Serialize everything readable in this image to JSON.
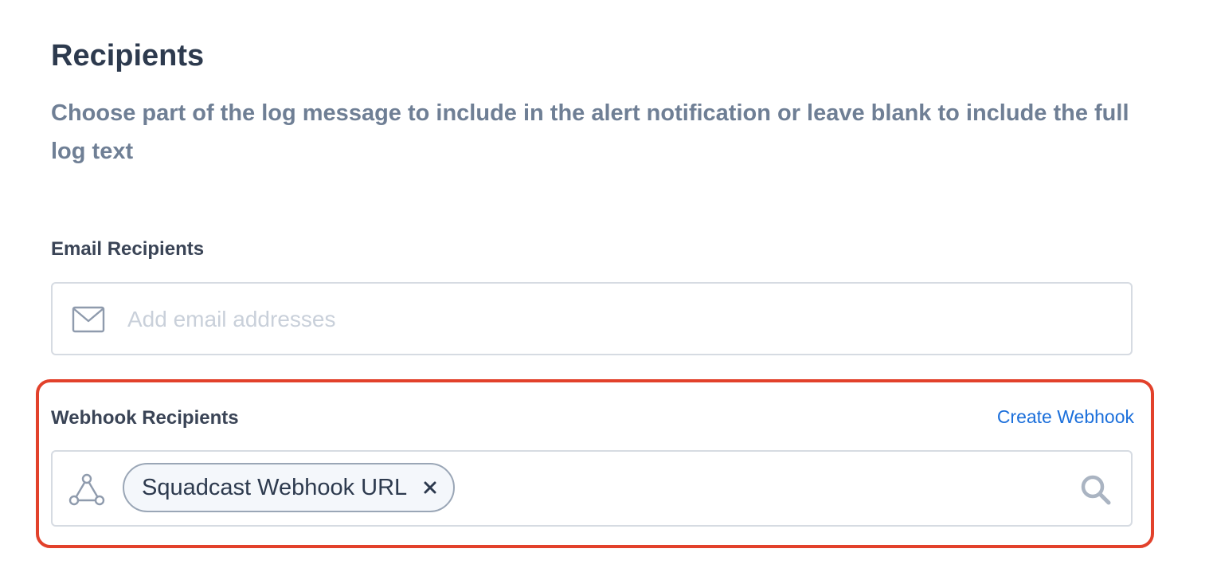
{
  "section": {
    "title": "Recipients",
    "description": "Choose part of the log message to include in the alert notification or leave blank to include the full log text"
  },
  "email": {
    "label": "Email Recipients",
    "placeholder": "Add email addresses",
    "icon": "mail-icon"
  },
  "webhook": {
    "label": "Webhook Recipients",
    "create_link": "Create Webhook",
    "icon": "webhook-icon",
    "chips": [
      {
        "label": "Squadcast Webhook URL",
        "remove_symbol": "×"
      }
    ],
    "search_icon": "search-icon"
  },
  "colors": {
    "heading": "#2d3a4e",
    "description": "#6f7f95",
    "link": "#1b6fdb",
    "highlight": "#e2412b",
    "border": "#d6dbe2"
  }
}
